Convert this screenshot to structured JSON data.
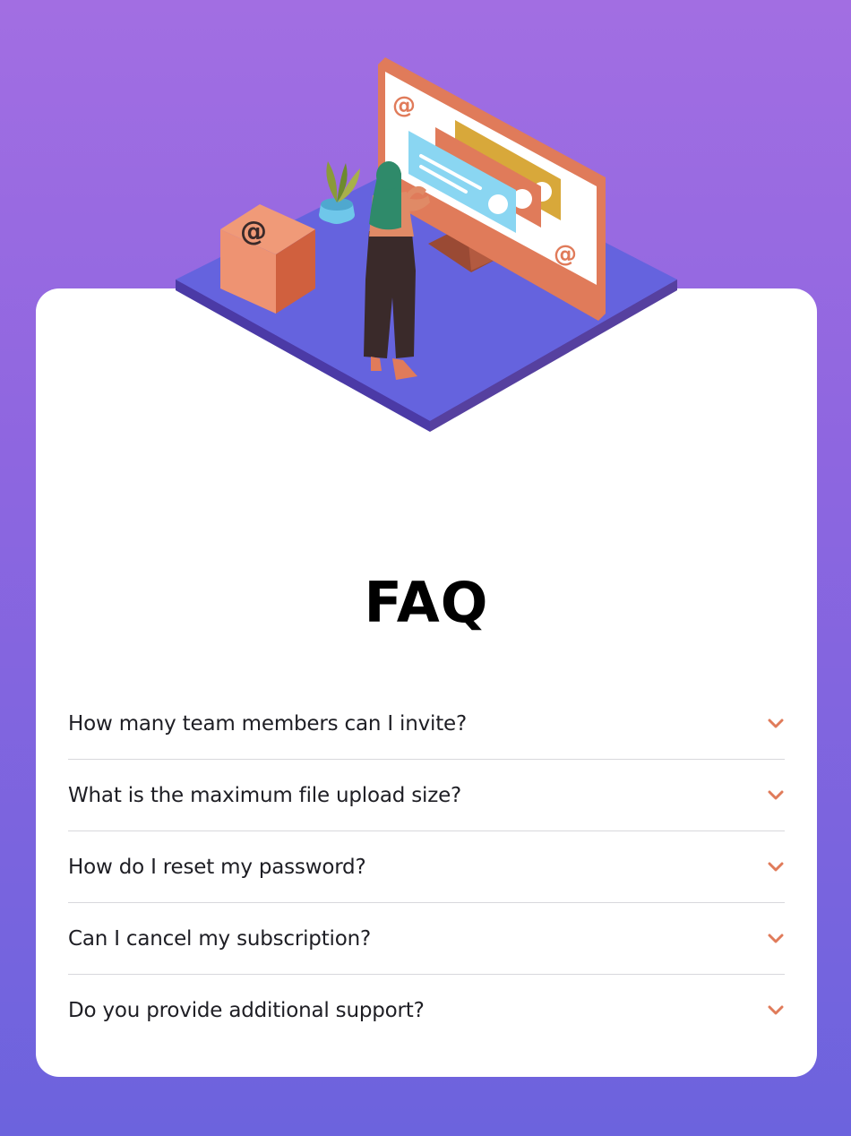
{
  "page": {
    "title": "FAQ"
  },
  "faq": {
    "items": [
      {
        "question": "How many team members can I invite?",
        "icon": "chevron-down-icon"
      },
      {
        "question": "What is the maximum file upload size?",
        "icon": "chevron-down-icon"
      },
      {
        "question": "How do I reset my password?",
        "icon": "chevron-down-icon"
      },
      {
        "question": "Can I cancel my subscription?",
        "icon": "chevron-down-icon"
      },
      {
        "question": "Do you provide additional support?",
        "icon": "chevron-down-icon"
      }
    ]
  },
  "colors": {
    "background_top": "#a26ee2",
    "background_bottom": "#6c63dd",
    "card": "#ffffff",
    "accent": "#e07b5a",
    "divider": "#d8d8dc",
    "text": "#1e1e24"
  }
}
